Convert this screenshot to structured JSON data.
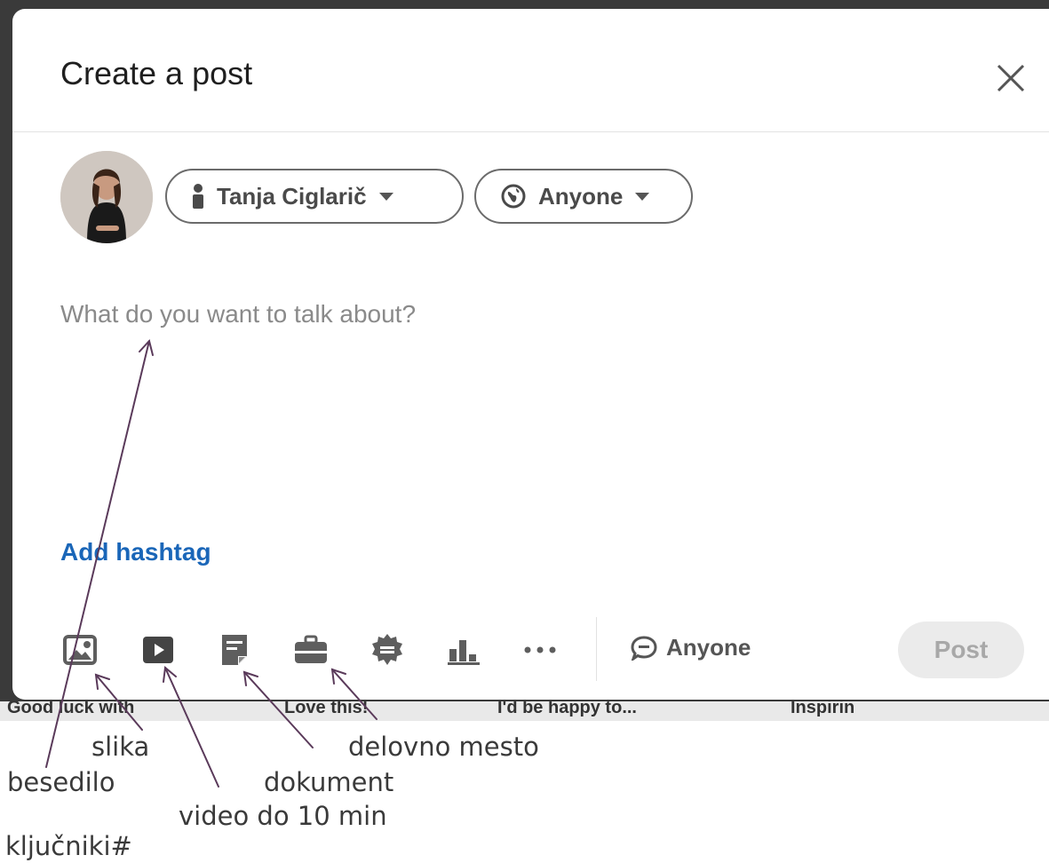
{
  "dialog": {
    "title": "Create a post",
    "author_label": "Tanja Ciglarič",
    "visibility_label": "Anyone",
    "placeholder": "What do you want to talk about?",
    "add_hashtag": "Add hashtag",
    "comment_setting": "Anyone",
    "post_button": "Post"
  },
  "toolbar_icons": [
    "photo-icon",
    "video-icon",
    "document-icon",
    "job-icon",
    "celebrate-icon",
    "poll-icon",
    "more-icon"
  ],
  "background_text": [
    "Good luck with",
    "Love this!",
    "I'd be happy to...",
    "Inspirin"
  ],
  "annotations": {
    "slika": "slika",
    "besedilo": "besedilo",
    "delovno_mesto": "delovno mesto",
    "dokument": "dokument",
    "video": "video do 10 min",
    "kljucniki": "ključniki#"
  },
  "colors": {
    "link_blue": "#1a66b8",
    "icon_gray": "#5e5e5e",
    "annotation_line": "#5a3a5a",
    "post_disabled_bg": "#ebebeb"
  }
}
